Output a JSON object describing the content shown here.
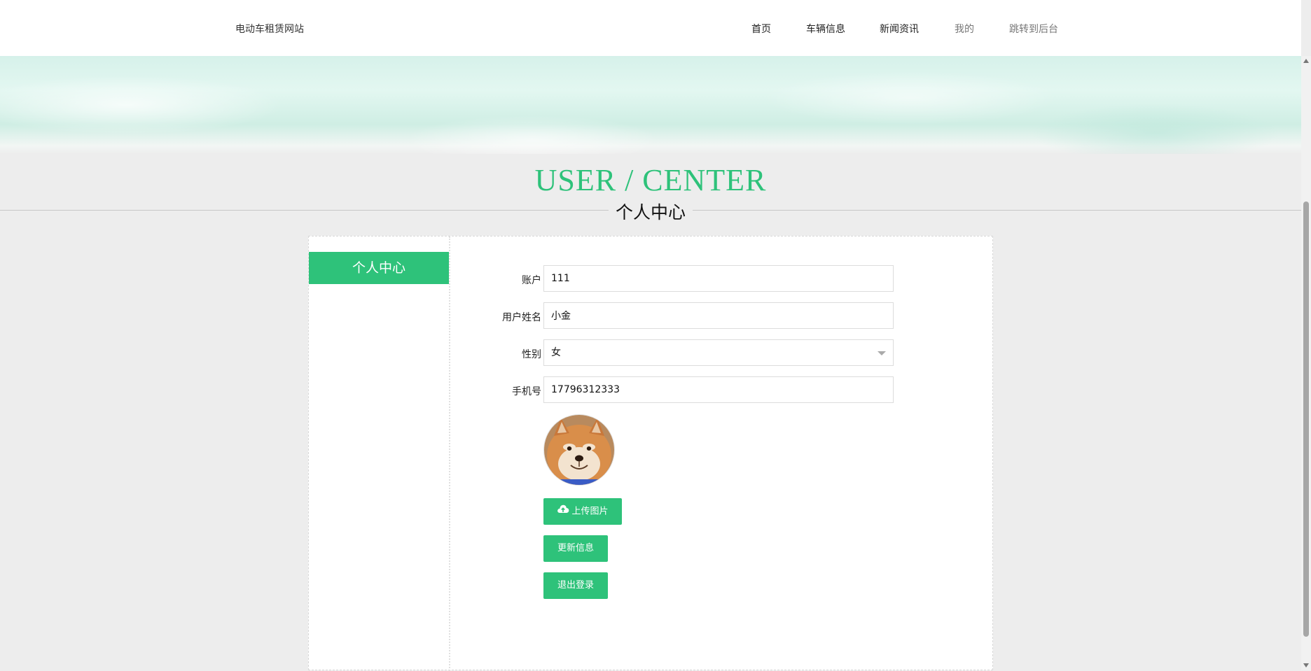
{
  "header": {
    "site_title": "电动车租赁网站",
    "nav": [
      {
        "label": "首页"
      },
      {
        "label": "车辆信息"
      },
      {
        "label": "新闻资讯"
      },
      {
        "label": "我的"
      },
      {
        "label": "跳转到后台"
      }
    ]
  },
  "section": {
    "title_en": "USER / CENTER",
    "title_cn": "个人中心"
  },
  "sidebar": {
    "items": [
      {
        "label": "个人中心"
      }
    ]
  },
  "form": {
    "account": {
      "label": "账户",
      "value": "111"
    },
    "name": {
      "label": "用户姓名",
      "value": "小金"
    },
    "gender": {
      "label": "性别",
      "value": "女"
    },
    "phone": {
      "label": "手机号",
      "value": "17796312333"
    },
    "upload_label": "上传图片",
    "update_label": "更新信息",
    "logout_label": "退出登录"
  },
  "colors": {
    "accent": "#2ec27a"
  }
}
